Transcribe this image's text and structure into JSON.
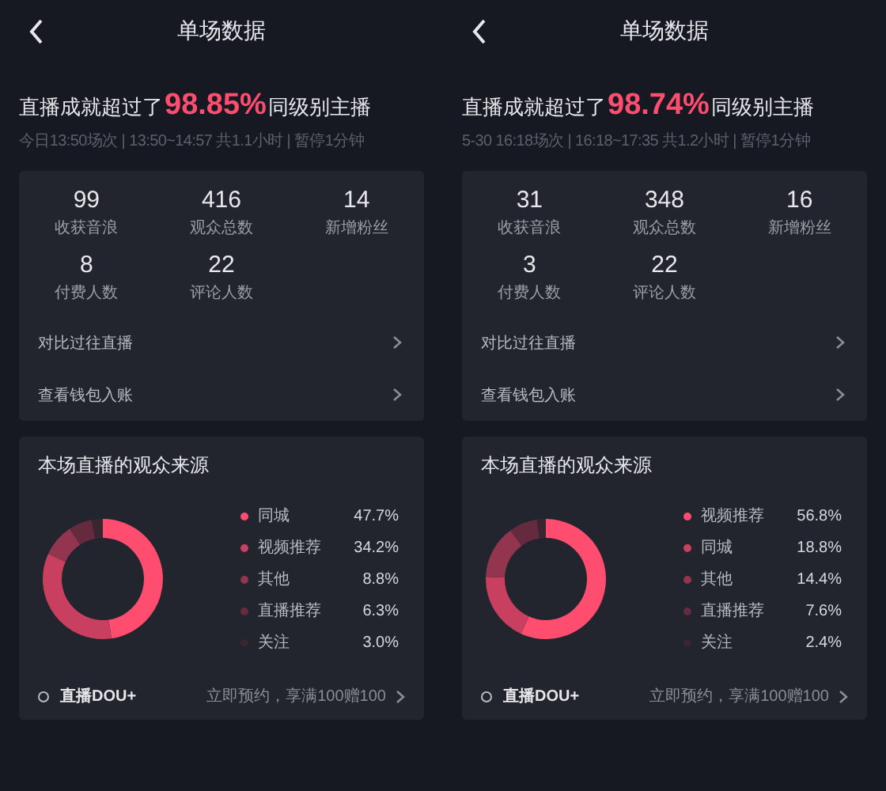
{
  "screens": [
    {
      "title": "单场数据",
      "headline": {
        "before": "直播成就超过了",
        "percent": "98.85%",
        "after": "同级别主播"
      },
      "session": "今日13:50场次 | 13:50~14:57 共1.1小时 | 暂停1分钟",
      "stats": [
        {
          "value": "99",
          "label": "收获音浪"
        },
        {
          "value": "416",
          "label": "观众总数"
        },
        {
          "value": "14",
          "label": "新增粉丝"
        },
        {
          "value": "8",
          "label": "付费人数"
        },
        {
          "value": "22",
          "label": "评论人数"
        }
      ],
      "links": [
        "对比过往直播",
        "查看钱包入账"
      ],
      "sources": {
        "title": "本场直播的观众来源",
        "legend": [
          {
            "name": "同城",
            "percent": "47.7%",
            "color": "#fe4d6e"
          },
          {
            "name": "视频推荐",
            "percent": "34.2%",
            "color": "#c83f60"
          },
          {
            "name": "其他",
            "percent": "8.8%",
            "color": "#93354f"
          },
          {
            "name": "直播推荐",
            "percent": "6.3%",
            "color": "#652a3e"
          },
          {
            "name": "关注",
            "percent": "3.0%",
            "color": "#3a2631"
          }
        ],
        "chart_data": {
          "type": "donut",
          "values": [
            47.7,
            34.2,
            8.8,
            6.3,
            3.0
          ]
        }
      },
      "footer": {
        "label": "直播DOU+",
        "promo": "立即预约，享满100赠100"
      }
    },
    {
      "title": "单场数据",
      "headline": {
        "before": "直播成就超过了",
        "percent": "98.74%",
        "after": "同级别主播"
      },
      "session": "5-30 16:18场次 | 16:18~17:35 共1.2小时 | 暂停1分钟",
      "stats": [
        {
          "value": "31",
          "label": "收获音浪"
        },
        {
          "value": "348",
          "label": "观众总数"
        },
        {
          "value": "16",
          "label": "新增粉丝"
        },
        {
          "value": "3",
          "label": "付费人数"
        },
        {
          "value": "22",
          "label": "评论人数"
        }
      ],
      "links": [
        "对比过往直播",
        "查看钱包入账"
      ],
      "sources": {
        "title": "本场直播的观众来源",
        "legend": [
          {
            "name": "视频推荐",
            "percent": "56.8%",
            "color": "#fe4d6e"
          },
          {
            "name": "同城",
            "percent": "18.8%",
            "color": "#c83f60"
          },
          {
            "name": "其他",
            "percent": "14.4%",
            "color": "#93354f"
          },
          {
            "name": "直播推荐",
            "percent": "7.6%",
            "color": "#652a3e"
          },
          {
            "name": "关注",
            "percent": "2.4%",
            "color": "#3a2631"
          }
        ],
        "chart_data": {
          "type": "donut",
          "values": [
            56.8,
            18.8,
            14.4,
            7.6,
            2.4
          ]
        }
      },
      "footer": {
        "label": "直播DOU+",
        "promo": "立即预约，享满100赠100"
      }
    }
  ]
}
